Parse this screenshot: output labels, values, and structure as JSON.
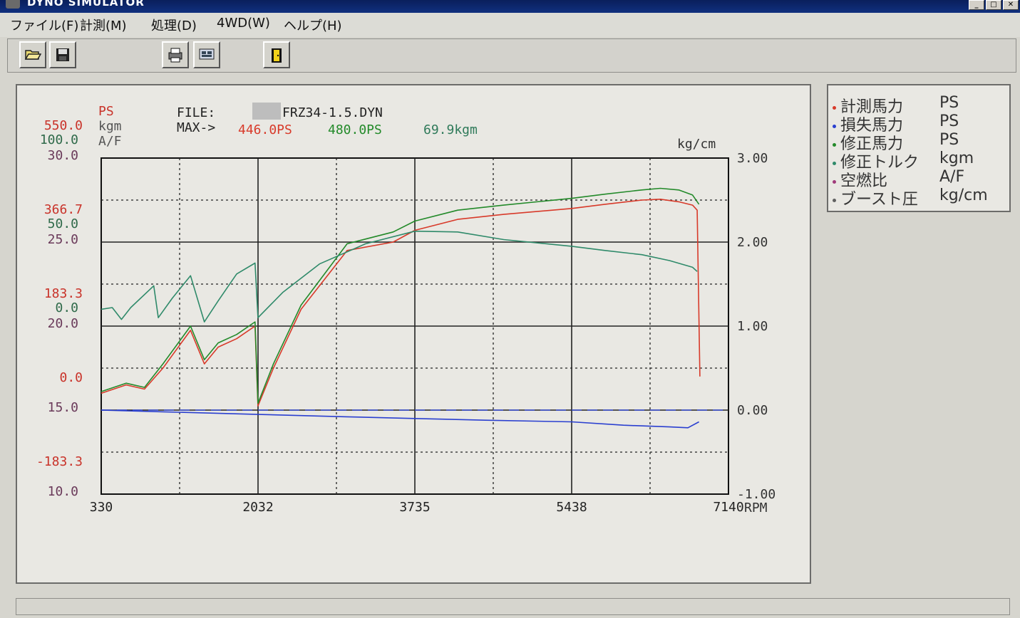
{
  "window": {
    "title": "DYNO SIMULATOR"
  },
  "menu": {
    "items": [
      "ファイル(F)",
      "計測(M)",
      "処理(D)",
      "4WD(W)",
      "ヘルプ(H)"
    ]
  },
  "toolbar": {
    "buttons": [
      "open-folder-icon",
      "save-disk-icon",
      "print-icon",
      "data-view-icon",
      "exit-door-icon"
    ]
  },
  "chart_header": {
    "file_label": "FILE:",
    "file_name": "FRZ34-1.5.DYN",
    "max_label": "MAX->",
    "max_measured": "446.0PS",
    "max_corrected": "480.0PS",
    "max_torque": "69.9kgm"
  },
  "chart_data": {
    "type": "line",
    "x_unit": "RPM",
    "x_range": [
      330,
      7140
    ],
    "x_ticks": [
      "330",
      "2032",
      "3735",
      "5438",
      "7140"
    ],
    "left_axis_units": [
      "PS",
      "kgm",
      "A/F"
    ],
    "left_axis_ps_ticks": [
      "550.0",
      "366.7",
      "183.3",
      "0.0",
      "-183.3"
    ],
    "left_axis_kgm_ticks": [
      "100.0",
      "50.0",
      "0.0"
    ],
    "left_axis_af_ticks": [
      "30.0",
      "25.0",
      "20.0",
      "15.0",
      "10.0"
    ],
    "right_axis_unit": "kg/cm",
    "right_axis_ticks": [
      "3.00",
      "2.00",
      "1.00",
      "0.00",
      "-1.00"
    ],
    "right_range": [
      -1.0,
      3.0
    ],
    "grid": true,
    "legend_position": "right",
    "colors": {
      "measured_hp": "#d83a2a",
      "loss_hp": "#2a3fd0",
      "corrected_hp": "#238a2a",
      "corrected_torque": "#2f8a6a",
      "af": "#a03a7a",
      "boost": "#606060"
    },
    "series": [
      {
        "name": "計測馬力",
        "unit": "PS",
        "color": "#d83a2a",
        "points": [
          [
            330,
            0.2
          ],
          [
            600,
            0.3
          ],
          [
            800,
            0.25
          ],
          [
            1000,
            0.5
          ],
          [
            1300,
            0.95
          ],
          [
            1450,
            0.55
          ],
          [
            1600,
            0.75
          ],
          [
            1800,
            0.85
          ],
          [
            2000,
            1.0
          ],
          [
            2032,
            0.05
          ],
          [
            2200,
            0.5
          ],
          [
            2500,
            1.2
          ],
          [
            3000,
            1.9
          ],
          [
            3500,
            2.0
          ],
          [
            3735,
            2.14
          ],
          [
            4200,
            2.27
          ],
          [
            4700,
            2.33
          ],
          [
            5438,
            2.4
          ],
          [
            5800,
            2.45
          ],
          [
            6200,
            2.5
          ],
          [
            6400,
            2.51
          ],
          [
            6600,
            2.48
          ],
          [
            6750,
            2.44
          ],
          [
            6800,
            2.38
          ],
          [
            6830,
            0.4
          ]
        ]
      },
      {
        "name": "損失馬力",
        "unit": "PS",
        "color": "#2a3fd0",
        "points": [
          [
            330,
            0.0
          ],
          [
            1000,
            -0.02
          ],
          [
            2000,
            -0.05
          ],
          [
            3000,
            -0.08
          ],
          [
            3735,
            -0.1
          ],
          [
            4500,
            -0.12
          ],
          [
            5438,
            -0.14
          ],
          [
            6000,
            -0.18
          ],
          [
            6500,
            -0.2
          ],
          [
            6700,
            -0.21
          ],
          [
            6820,
            -0.14
          ]
        ]
      },
      {
        "name": "修正馬力",
        "unit": "PS",
        "color": "#238a2a",
        "points": [
          [
            330,
            0.22
          ],
          [
            600,
            0.32
          ],
          [
            800,
            0.27
          ],
          [
            1000,
            0.55
          ],
          [
            1300,
            1.0
          ],
          [
            1450,
            0.6
          ],
          [
            1600,
            0.8
          ],
          [
            1800,
            0.9
          ],
          [
            2000,
            1.05
          ],
          [
            2032,
            0.08
          ],
          [
            2200,
            0.55
          ],
          [
            2500,
            1.25
          ],
          [
            3000,
            1.98
          ],
          [
            3500,
            2.12
          ],
          [
            3735,
            2.25
          ],
          [
            4200,
            2.38
          ],
          [
            4700,
            2.44
          ],
          [
            5438,
            2.52
          ],
          [
            5800,
            2.57
          ],
          [
            6200,
            2.62
          ],
          [
            6400,
            2.64
          ],
          [
            6600,
            2.62
          ],
          [
            6750,
            2.56
          ],
          [
            6820,
            2.45
          ]
        ]
      },
      {
        "name": "修正トルク",
        "unit": "kgm",
        "color": "#2f8a6a",
        "points": [
          [
            330,
            1.2
          ],
          [
            450,
            1.22
          ],
          [
            550,
            1.08
          ],
          [
            650,
            1.22
          ],
          [
            900,
            1.48
          ],
          [
            950,
            1.1
          ],
          [
            1100,
            1.33
          ],
          [
            1300,
            1.6
          ],
          [
            1450,
            1.05
          ],
          [
            1600,
            1.3
          ],
          [
            1800,
            1.62
          ],
          [
            2000,
            1.75
          ],
          [
            2032,
            1.1
          ],
          [
            2300,
            1.4
          ],
          [
            2700,
            1.74
          ],
          [
            3200,
            1.98
          ],
          [
            3735,
            2.13
          ],
          [
            4200,
            2.12
          ],
          [
            4700,
            2.03
          ],
          [
            5438,
            1.95
          ],
          [
            5800,
            1.9
          ],
          [
            6200,
            1.85
          ],
          [
            6500,
            1.78
          ],
          [
            6750,
            1.7
          ],
          [
            6800,
            1.65
          ]
        ]
      }
    ]
  },
  "legend": {
    "items": [
      {
        "label": "計測馬力",
        "unit": "PS",
        "color": "#d83a2a"
      },
      {
        "label": "損失馬力",
        "unit": "PS",
        "color": "#2a3fd0"
      },
      {
        "label": "修正馬力",
        "unit": "PS",
        "color": "#238a2a"
      },
      {
        "label": "修正トルク",
        "unit": "kgm",
        "color": "#2f8a6a"
      },
      {
        "label": "空燃比",
        "unit": "A/F",
        "color": "#a03a7a"
      },
      {
        "label": "ブースト圧",
        "unit": "kg/cm",
        "color": "#606060"
      }
    ]
  }
}
